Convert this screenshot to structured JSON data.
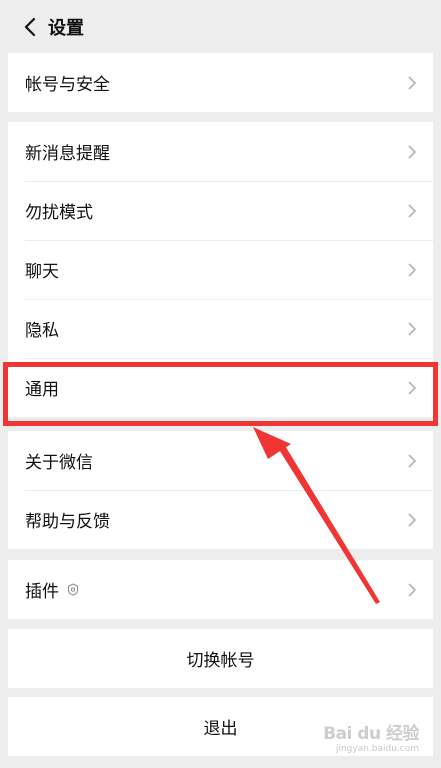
{
  "header": {
    "title": "设置",
    "back_icon": "chevron-left-icon"
  },
  "groups": {
    "account": {
      "items": [
        {
          "label": "帐号与安全"
        }
      ]
    },
    "main": {
      "items": [
        {
          "label": "新消息提醒"
        },
        {
          "label": "勿扰模式"
        },
        {
          "label": "聊天"
        },
        {
          "label": "隐私"
        },
        {
          "label": "通用"
        }
      ]
    },
    "about": {
      "items": [
        {
          "label": "关于微信"
        },
        {
          "label": "帮助与反馈"
        }
      ]
    },
    "plugins": {
      "items": [
        {
          "label": "插件",
          "icon": "plugin-icon"
        }
      ]
    }
  },
  "actions": {
    "switch_account": "切换帐号",
    "logout": "退出"
  },
  "annotation": {
    "highlight_color": "#f03535",
    "highlighted_item": "通用"
  },
  "watermark": {
    "main": "Bai du 经验",
    "sub": "jingyan.baidu.com"
  },
  "colors": {
    "background": "#ededed",
    "row": "#ffffff",
    "chevron": "#b2b2b2"
  }
}
